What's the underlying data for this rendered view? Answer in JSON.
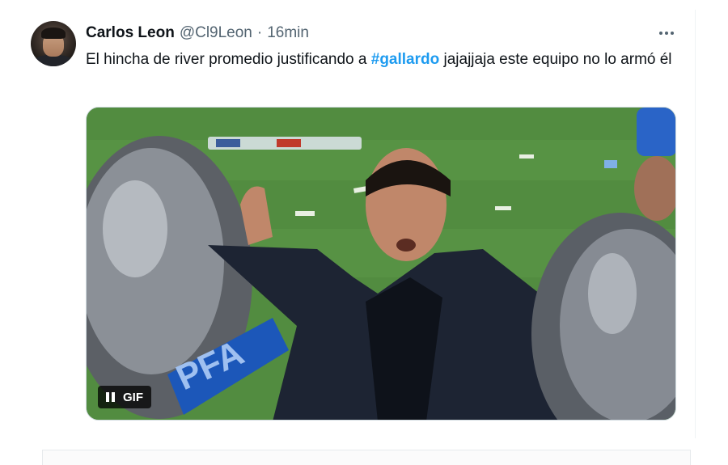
{
  "tweet": {
    "author_name": "Carlos Leon",
    "handle": "@Cl9Leon",
    "separator": "·",
    "time": "16min",
    "text_before": "El hincha de river promedio justificando a ",
    "hashtag": "#gallardo",
    "text_after": " jajajjaja este equipo no lo armó él"
  },
  "media": {
    "badge_label": "GIF",
    "shield_text": "PFA",
    "icons": [
      "pause-icon",
      "more-icon"
    ]
  },
  "colors": {
    "link": "#1d9bf0",
    "secondary_text": "#536471"
  }
}
